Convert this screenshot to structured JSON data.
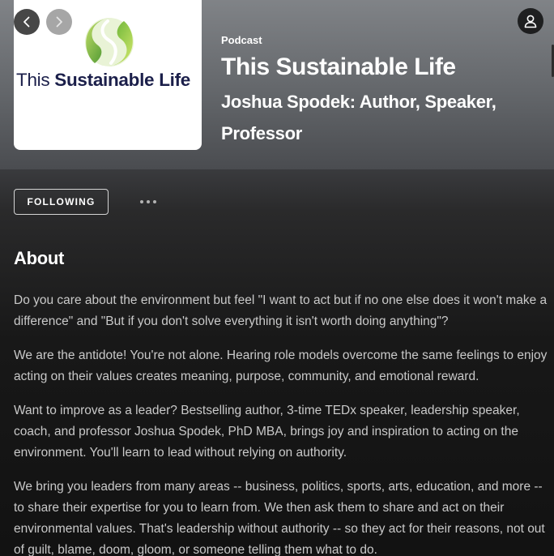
{
  "navigation": {
    "back_icon": "chevron-left-icon",
    "forward_icon": "chevron-right-icon",
    "user_icon": "user-icon"
  },
  "cover": {
    "title_regular": "This ",
    "title_bold": "Sustainable Life",
    "logo_colors": [
      "#4c9a2a",
      "#a8d14f",
      "#1b1f4a"
    ]
  },
  "header": {
    "type_label": "Podcast",
    "title": "This Sustainable Life",
    "publisher": "Joshua Spodek: Author, Speaker, Professor"
  },
  "actions": {
    "follow_label": "FOLLOWING",
    "more_icon": "more-options-icon"
  },
  "about": {
    "heading": "About",
    "paragraphs": [
      "Do you care about the environment but feel \"I want to act but if no one else does it won't make a difference\" and \"But if you don't solve everything it isn't worth doing anything\"?",
      "We are the antidote! You're not alone. Hearing role models overcome the same feelings to enjoy acting on their values creates meaning, purpose, community, and emotional reward.",
      "Want to improve as a leader? Bestselling author, 3-time TEDx speaker, leadership speaker, coach, and professor Joshua Spodek, PhD MBA, brings joy and inspiration to acting on the environment. You'll learn to lead without relying on authority.",
      "We bring you leaders from many areas -- business, politics, sports, arts, education, and more -- to share their expertise for you to learn from. We then ask them to share and act on their environmental values. That's leadership without authority -- so they act for their reasons, not out of guilt, blame, doom, gloom, or someone telling them what to do."
    ]
  }
}
